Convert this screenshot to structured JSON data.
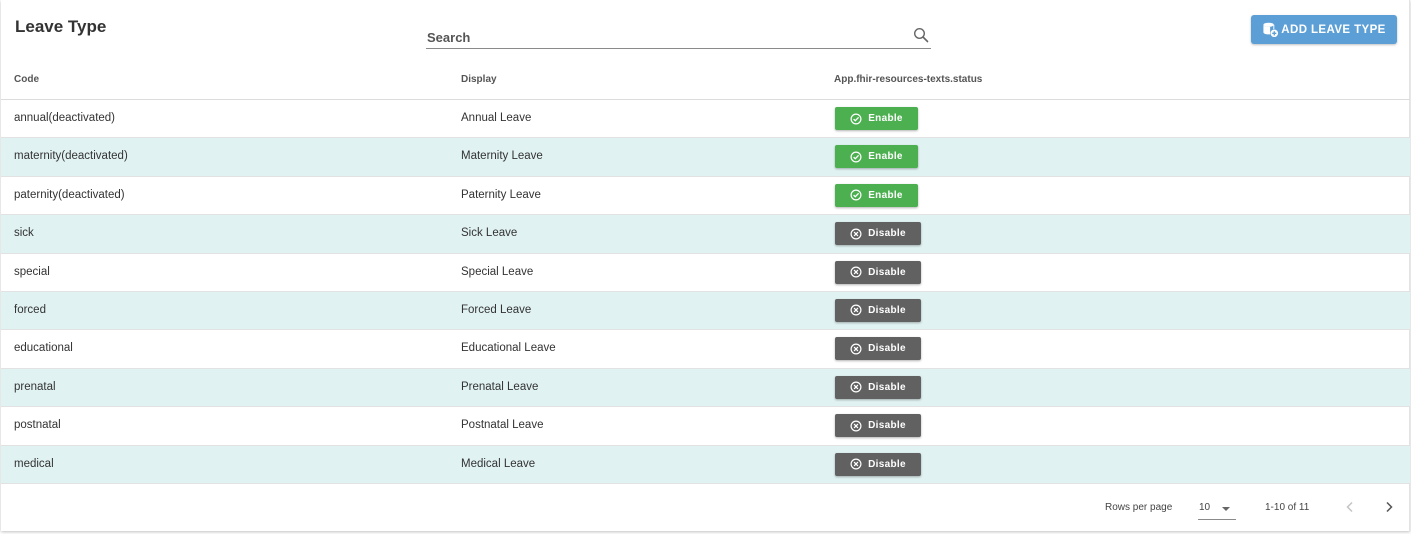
{
  "header": {
    "title": "Leave Type",
    "search_placeholder": "Search",
    "search_value": "",
    "add_button_label": "ADD LEAVE TYPE"
  },
  "table": {
    "columns": [
      "Code",
      "Display",
      "App.fhir-resources-texts.status"
    ],
    "rows": [
      {
        "code": "annual(deactivated)",
        "display": "Annual Leave",
        "action": "Enable"
      },
      {
        "code": "maternity(deactivated)",
        "display": "Maternity Leave",
        "action": "Enable"
      },
      {
        "code": "paternity(deactivated)",
        "display": "Paternity Leave",
        "action": "Enable"
      },
      {
        "code": "sick",
        "display": "Sick Leave",
        "action": "Disable"
      },
      {
        "code": "special",
        "display": "Special Leave",
        "action": "Disable"
      },
      {
        "code": "forced",
        "display": "Forced Leave",
        "action": "Disable"
      },
      {
        "code": "educational",
        "display": "Educational Leave",
        "action": "Disable"
      },
      {
        "code": "prenatal",
        "display": "Prenatal Leave",
        "action": "Disable"
      },
      {
        "code": "postnatal",
        "display": "Postnatal Leave",
        "action": "Disable"
      },
      {
        "code": "medical",
        "display": "Medical Leave",
        "action": "Disable"
      }
    ]
  },
  "pagination": {
    "rows_per_page_label": "Rows per page",
    "rows_per_page_value": "10",
    "range_label": "1-10 of 11"
  },
  "colors": {
    "enable": "#4caf50",
    "disable": "#616161",
    "primary": "#5b9fd6",
    "row_alt": "#e1f2f2"
  },
  "icons": {
    "search": "search-icon",
    "add": "database-add-icon",
    "enable": "check-circle-icon",
    "disable": "x-circle-icon",
    "prev": "chevron-left-icon",
    "next": "chevron-right-icon"
  }
}
